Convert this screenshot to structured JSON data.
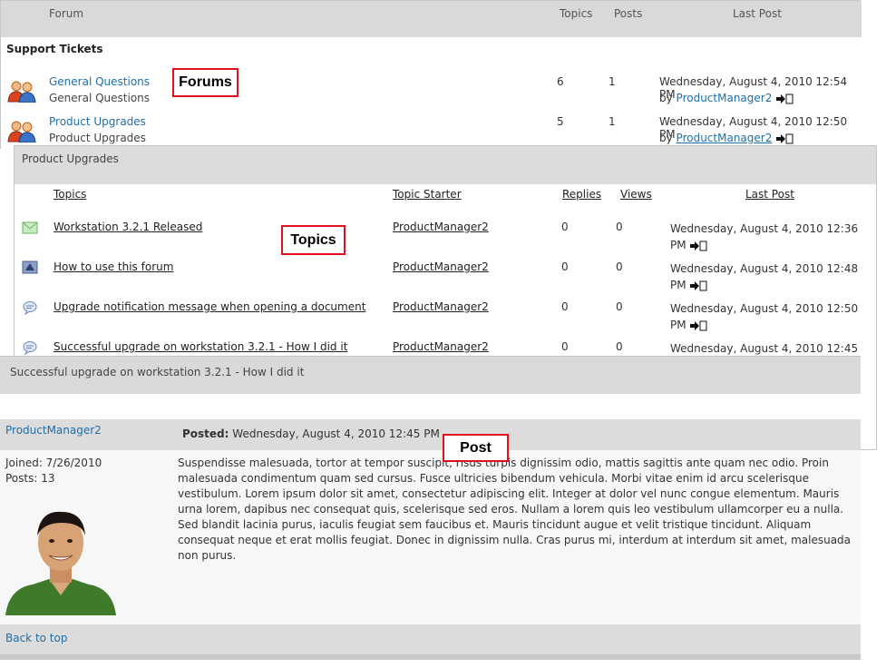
{
  "forums_panel": {
    "headers": {
      "forum": "Forum",
      "topics": "Topics",
      "posts": "Posts",
      "last_post": "Last Post"
    },
    "section_title": "Support Tickets",
    "rows": [
      {
        "name": "General Questions",
        "description": "General Questions",
        "topics": "6",
        "posts": "1",
        "last_post_date": "Wednesday, August 4, 2010 12:54 PM",
        "by_label": "by",
        "last_post_user": "ProductManager2"
      },
      {
        "name": "Product Upgrades",
        "description": "Product Upgrades",
        "topics": "5",
        "posts": "1",
        "last_post_date": "Wednesday, August 4, 2010 12:50 PM",
        "by_label": "by",
        "last_post_user": "ProductManager2"
      }
    ]
  },
  "topics_panel": {
    "title": "Product Upgrades",
    "headers": {
      "topics": "Topics",
      "starter": "Topic Starter",
      "replies": "Replies",
      "views": "Views",
      "last_post": "Last Post"
    },
    "rows": [
      {
        "icon": "mail-icon",
        "title": "Workstation 3.2.1 Released",
        "starter": "ProductManager2",
        "replies": "0",
        "views": "0",
        "last_line1": "Wednesday, August 4, 2010 12:36",
        "last_line2": "PM"
      },
      {
        "icon": "announcement-icon",
        "title": "How to use this forum",
        "starter": "ProductManager2",
        "replies": "0",
        "views": "0",
        "last_line1": "Wednesday, August 4, 2010 12:48",
        "last_line2": "PM"
      },
      {
        "icon": "speech-bubble-icon",
        "title": "Upgrade notification message when opening a document",
        "starter": "ProductManager2",
        "replies": "0",
        "views": "0",
        "last_line1": "Wednesday, August 4, 2010 12:50",
        "last_line2": "PM"
      },
      {
        "icon": "speech-bubble-icon",
        "title": "Successful upgrade on workstation 3.2.1 - How I did it",
        "starter": "ProductManager2",
        "replies": "0",
        "views": "0",
        "last_line1": "Wednesday, August 4, 2010 12:45",
        "last_line2": ""
      }
    ]
  },
  "post_panel": {
    "title": "Successful upgrade on workstation 3.2.1 - How I did it",
    "author": "ProductManager2",
    "posted_label": "Posted:",
    "posted_date": "Wednesday, August 4, 2010 12:45 PM",
    "joined": "Joined: 7/26/2010",
    "posts": "Posts: 13",
    "body": "Suspendisse malesuada, tortor at tempor suscipit, risus turpis dignissim odio, mattis sagittis ante quam nec odio. Proin malesuada condimentum quam sed cursus. Fusce ultricies bibendum vehicula. Morbi vitae enim id arcu scelerisque vestibulum. Lorem ipsum dolor sit amet, consectetur adipiscing elit. Integer at dolor vel nunc congue elementum. Mauris urna lorem, dapibus nec consequat quis, scelerisque sed eros. Nullam a lorem quis leo vestibulum ullamcorper eu a nulla. Sed blandit lacinia purus, iaculis feugiat sem faucibus et. Mauris tincidunt augue et velit tristique tincidunt. Aliquam consequat neque et erat mollis feugiat. Donec in dignissim nulla. Cras purus mi, interdum at interdum sit amet, malesuada non purus.",
    "back_to_top": "Back to top"
  },
  "callouts": {
    "forums": "Forums",
    "topics": "Topics",
    "post": "Post"
  },
  "colors": {
    "link": "#1f6fa8",
    "header_bg": "#d9d9d9",
    "callout_border": "#e0101c"
  }
}
